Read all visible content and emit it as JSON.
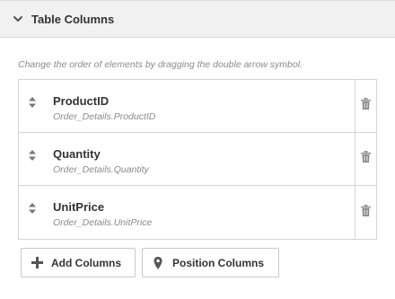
{
  "panel": {
    "title": "Table Columns",
    "hint": "Change the order of elements by dragging the double arrow symbol.",
    "columns": [
      {
        "name": "ProductID",
        "source": "Order_Details.ProductID"
      },
      {
        "name": "Quantity",
        "source": "Order_Details.Quantity"
      },
      {
        "name": "UnitPrice",
        "source": "Order_Details.UnitPrice"
      }
    ],
    "buttons": {
      "add_label": "Add Columns",
      "position_label": "Position Columns"
    }
  },
  "icons": {
    "header": "chevron-down-icon",
    "drag": "double-arrow-icon",
    "delete": "trash-icon",
    "add": "plus-icon",
    "position": "map-pin-icon"
  },
  "colors": {
    "header_bg": "#f1f1f1",
    "border": "#d4d4d4",
    "text": "#333333",
    "muted_text": "#8a8a8a"
  }
}
